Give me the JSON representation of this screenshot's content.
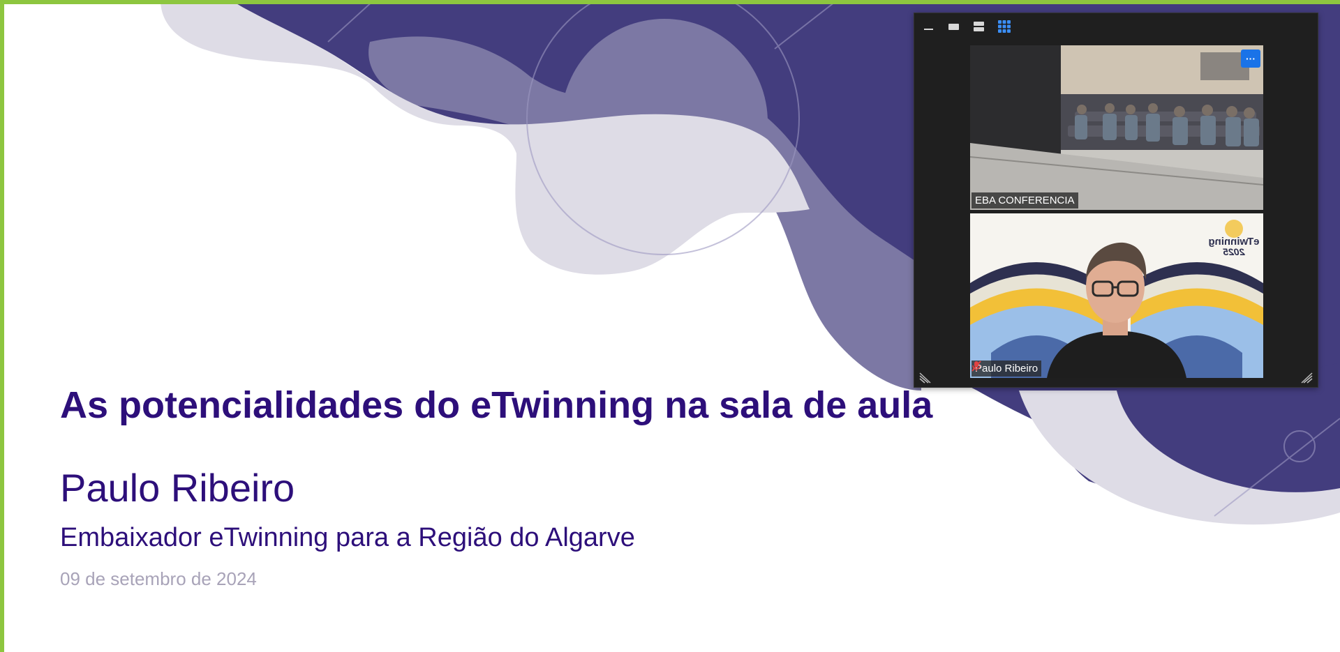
{
  "slide": {
    "title": "As potencialidades do eTwinning na sala de aula",
    "presenter_name": "Paulo Ribeiro",
    "presenter_role": "Embaixador eTwinning para a Região do Algarve",
    "date": "09 de setembro de 2024"
  },
  "meeting_panel": {
    "toolbar": [
      {
        "name": "minimize",
        "icon": "minimize-icon"
      },
      {
        "name": "single-view",
        "icon": "single-view-icon"
      },
      {
        "name": "stacked-view",
        "icon": "stacked-view-icon"
      },
      {
        "name": "grid-view",
        "icon": "grid-view-icon",
        "active": true
      }
    ],
    "participants": [
      {
        "name": "EBA CONFERENCIA",
        "muted": false
      },
      {
        "name": "Paulo Ribeiro",
        "muted": true
      }
    ],
    "more_label": "···",
    "logo_text": "eTwinning",
    "logo_year": "2025"
  },
  "colors": {
    "frame": "#8dc63f",
    "title": "#2d0f7a",
    "date": "#a8a3b8",
    "wave_dark": "#433d7e",
    "wave_mid": "#7c78a4",
    "wave_light": "#dedce6",
    "accent_blue": "#1a73e8"
  }
}
